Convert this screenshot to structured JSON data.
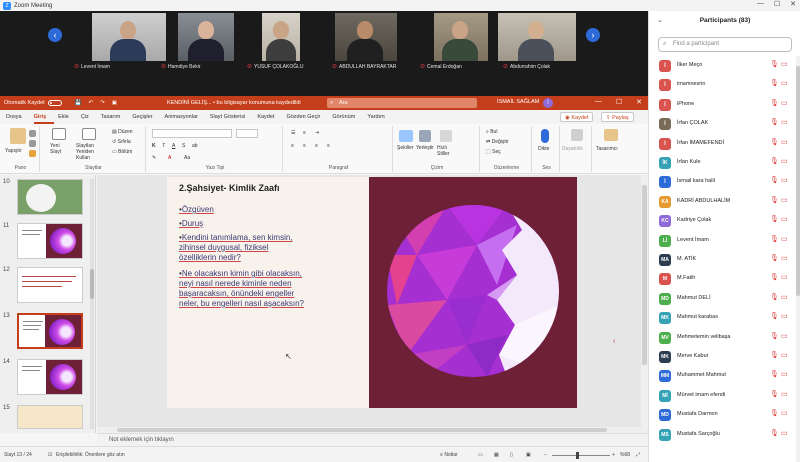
{
  "app": {
    "title": "Zoom Meeting"
  },
  "videos": [
    {
      "name": "Levent İmam"
    },
    {
      "name": "Hamdiye Bekir"
    },
    {
      "name": "YUSUF ÇOLAKOĞLU"
    },
    {
      "name": "ABDULLAH BAYRAKTAR"
    },
    {
      "name": "Cemal Erdoğan"
    },
    {
      "name": "Abdurrahim Çolak"
    }
  ],
  "ppt": {
    "autosave": "Otomatik Kaydet",
    "docname": "KENDİNİ GELİŞ... • bu bilgisayar konumuna kaydedildi",
    "search": "Ara",
    "user": "İSMAİL SAĞLAM",
    "menu": [
      "Dosya",
      "Giriş",
      "Ekle",
      "Çiz",
      "Tasarım",
      "Geçişler",
      "Animasyonlar",
      "Slayt Gösterisi",
      "Kaydet",
      "Gözden Geçir",
      "Görünüm",
      "Yardım"
    ],
    "record_btn": "Kaydet",
    "share_btn": "Paylaş",
    "ribbon": {
      "paste": "Yapıştır",
      "clipboard": "Pano",
      "new_slide": "Yeni Slayt",
      "reuse": "Slaytları Yeniden Kullan",
      "layout": "Düzen",
      "reset": "Sıfırla",
      "section": "Bölüm",
      "slides": "Slaytlar",
      "font": "Yazı Tipi",
      "paragraph": "Paragraf",
      "shapes": "Şekiller",
      "arrange": "Yerleştir",
      "quick_styles": "Hızlı Stiller",
      "drawing": "Çizim",
      "find": "Bul",
      "replace": "Değiştir",
      "select": "Seç",
      "editing": "Düzenleme",
      "dictate": "Dikte",
      "voice": "Ses",
      "sensitivity": "Duyarlılık",
      "designer": "Tasarımcı"
    },
    "thumb_numbers": [
      "10",
      "11",
      "12",
      "13",
      "14",
      "15"
    ],
    "slide": {
      "title": "2.Şahsiyet- Kimlik Zaafı",
      "bullets": [
        "Özgüven",
        "Duruş",
        "Kendini tanımlama, sen kimsin, zihinsel duygusal, fiziksel özelliklerin nedir?",
        "Ne olacaksın kimin gibi olacaksın, neyi nasıl nerede kiminle neden başaracaksın, önündeki engeller neler, bu engelleri nasıl aşacaksın?"
      ],
      "bullet_lines": [
        [
          "Özgüven"
        ],
        [
          "Duruş"
        ],
        [
          "Kendini tanımlama, sen kimsin,",
          "zihinsel duygusal, fiziksel",
          "özelliklerin nedir?"
        ],
        [
          "Ne olacaksın kimin gibi olacaksın,",
          "neyi nasıl nerede kiminle neden",
          "başaracaksın, önündeki engeller",
          "neler, bu engelleri nasıl aşacaksın?"
        ]
      ]
    },
    "notes": "Not eklemek için tıklayın",
    "status": {
      "slide_count": "Slayt 13 / 24",
      "accessibility": "Erişilebilirlik: Önerilere göz atın",
      "notes": "Notlar",
      "zoom": "%68"
    }
  },
  "participants": {
    "title": "Participants (83)",
    "search_placeholder": "Find a participant",
    "items": [
      {
        "initials": "İ",
        "name": "İlker Meço",
        "color": "#d9534f"
      },
      {
        "initials": "İ",
        "name": "imamnesrin",
        "color": "#d9534f"
      },
      {
        "initials": "İ",
        "name": "iPhone",
        "color": "#d9534f"
      },
      {
        "initials": "İ",
        "name": "İrfan ÇOLAK",
        "color": "#7a6a58"
      },
      {
        "initials": "İ",
        "name": "İrfan İMAMEFENDİ",
        "color": "#d9534f"
      },
      {
        "initials": "İK",
        "name": "İrfan Kule",
        "color": "#35a3b5"
      },
      {
        "initials": "İ",
        "name": "İsmail kara halil",
        "color": "#2d6bd9"
      },
      {
        "initials": "KA",
        "name": "KADRİ ABDULHALİM",
        "color": "#e59a2f"
      },
      {
        "initials": "KC",
        "name": "Kadriye Çolak",
        "color": "#8e6bd8"
      },
      {
        "initials": "Lİ",
        "name": "Levent İmam",
        "color": "#4cae4c"
      },
      {
        "initials": "MA",
        "name": "M. ATİK",
        "color": "#2c3e50"
      },
      {
        "initials": "M",
        "name": "M.Fatih",
        "color": "#d9534f"
      },
      {
        "initials": "MD",
        "name": "Mahmut DELİ",
        "color": "#4cae4c"
      },
      {
        "initials": "MK",
        "name": "Mahmut karabas",
        "color": "#35a3b5"
      },
      {
        "initials": "MV",
        "name": "Mehmetemin velibaşa",
        "color": "#4cae4c"
      },
      {
        "initials": "MK",
        "name": "Merve Kabur",
        "color": "#2c3e50"
      },
      {
        "initials": "MM",
        "name": "Muhammet Mahmut",
        "color": "#2d6bd9"
      },
      {
        "initials": "Mİ",
        "name": "Mürvet imam efendi",
        "color": "#35a3b5"
      },
      {
        "initials": "MD",
        "name": "Mustafa Darmon",
        "color": "#2d6bd9"
      },
      {
        "initials": "MS",
        "name": "Mustafa Sarçoğlu",
        "color": "#35a3b5"
      }
    ]
  }
}
